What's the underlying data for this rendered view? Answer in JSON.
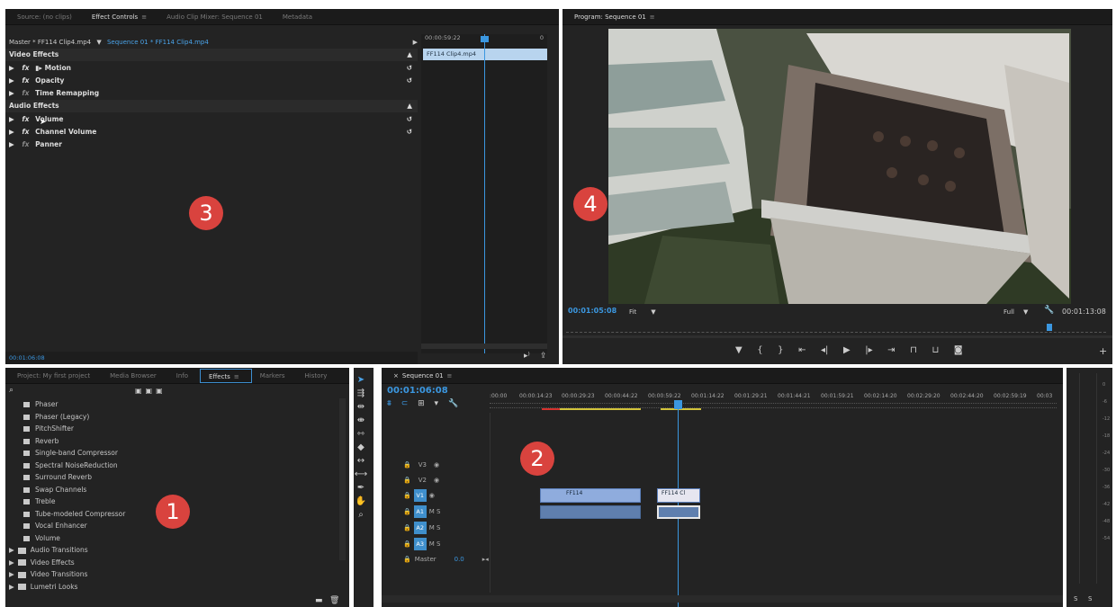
{
  "source_panel": {
    "tabs": [
      "Source: (no clips)",
      "Effect Controls",
      "Audio Clip Mixer: Sequence 01",
      "Metadata"
    ],
    "master_label": "Master * FF114 Clip4.mp4",
    "sequence_label": "Sequence 01 * FF114 Clip4.mp4",
    "mini_timecode": "00:00:59:22",
    "mini_end": "0",
    "mini_clip": "FF114 Clip4.mp4",
    "video_effects_header": "Video Effects",
    "audio_effects_header": "Audio Effects",
    "video_effects": [
      "Motion",
      "Opacity",
      "Time Remapping"
    ],
    "audio_effects": [
      "Volume",
      "Channel Volume",
      "Panner"
    ],
    "footer_timecode": "00:01:06:08",
    "badge": "3"
  },
  "program_panel": {
    "title": "Program: Sequence 01",
    "current_timecode": "00:01:05:08",
    "fit_label": "Fit",
    "quality_label": "Full",
    "duration_timecode": "00:01:13:08",
    "badge": "4"
  },
  "project_panel": {
    "tabs": [
      "Project: My first project",
      "Media Browser",
      "Info",
      "Effects",
      "Markers",
      "History"
    ],
    "items": [
      "Phaser",
      "Phaser (Legacy)",
      "PitchShifter",
      "Reverb",
      "Single-band Compressor",
      "Spectral NoiseReduction",
      "Surround Reverb",
      "Swap Channels",
      "Treble",
      "Tube-modeled Compressor",
      "Vocal Enhancer",
      "Volume"
    ],
    "folders": [
      "Audio Transitions",
      "Video Effects",
      "Video Transitions",
      "Lumetri Looks"
    ],
    "badge": "1"
  },
  "timeline_panel": {
    "tab": "Sequence 01",
    "timecode": "00:01:06:08",
    "ruler": [
      ":00:00",
      "00:00:14:23",
      "00:00:29:23",
      "00:00:44:22",
      "00:00:59:22",
      "00:01:14:22",
      "00:01:29:21",
      "00:01:44:21",
      "00:01:59:21",
      "00:02:14:20",
      "00:02:29:20",
      "00:02:44:20",
      "00:02:59:19",
      "00:03"
    ],
    "tracks": [
      "V3",
      "V2",
      "V1",
      "A1",
      "A2",
      "A3"
    ],
    "master_label": "Master",
    "master_value": "0.0",
    "clip1": "FF114",
    "clip2": "FF114 Cl",
    "badge": "2"
  },
  "meter": {
    "labels": [
      "0",
      "-6",
      "-12",
      "-18",
      "-24",
      "-30",
      "-36",
      "-42",
      "-48",
      "-54"
    ],
    "bottom": [
      "S",
      "S"
    ]
  }
}
